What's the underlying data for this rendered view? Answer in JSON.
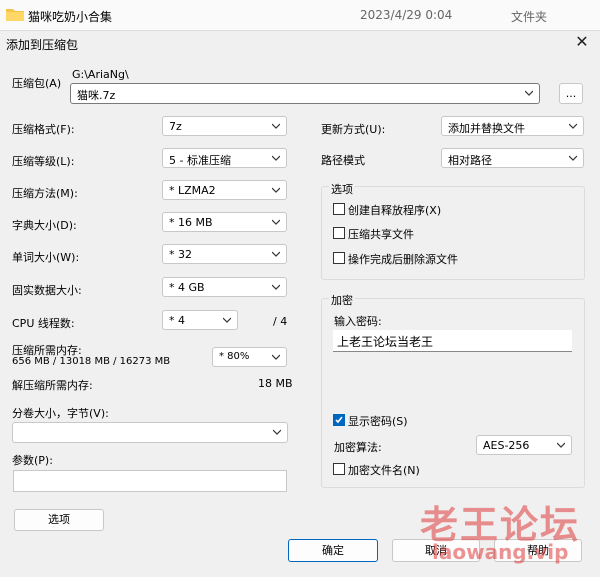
{
  "file_row": {
    "name": "猫咪吃奶小合集",
    "date": "2023/4/29 0:04",
    "type": "文件夹"
  },
  "dialog": {
    "title": "添加到压缩包",
    "close_symbol": "✕"
  },
  "archive": {
    "label": "压缩包(A)",
    "path": "G:\\AriaNg\\",
    "value": "猫咪.7z",
    "browse": "..."
  },
  "fields": {
    "format": {
      "label": "压缩格式(F):",
      "value": "7z"
    },
    "level": {
      "label": "压缩等级(L):",
      "value": "5 - 标准压缩"
    },
    "method": {
      "label": "压缩方法(M):",
      "value": "* LZMA2"
    },
    "dict": {
      "label": "字典大小(D):",
      "value": "* 16 MB"
    },
    "word": {
      "label": "单词大小(W):",
      "value": "* 32"
    },
    "solid": {
      "label": "固实数据大小:",
      "value": "* 4 GB"
    },
    "threads": {
      "label": "CPU 线程数:",
      "value": "* 4",
      "total": "/ 4"
    },
    "memory": {
      "label": "压缩所需内存:",
      "detail": "656 MB / 13018 MB / 16273 MB",
      "value": "* 80%"
    },
    "decomp": {
      "label": "解压缩所需内存:",
      "value": "18 MB"
    },
    "split": {
      "label": "分卷大小，字节(V):",
      "value": ""
    },
    "params": {
      "label": "参数(P):",
      "value": ""
    }
  },
  "update": {
    "label": "更新方式(U):",
    "value": "添加并替换文件"
  },
  "pathmode": {
    "label": "路径模式",
    "value": "相对路径"
  },
  "options": {
    "title": "选项",
    "items": [
      {
        "label": "创建自释放程序(X)",
        "checked": false
      },
      {
        "label": "压缩共享文件",
        "checked": false
      },
      {
        "label": "操作完成后删除源文件",
        "checked": false
      }
    ]
  },
  "encryption": {
    "title": "加密",
    "pw_label": "输入密码:",
    "pw_value": "上老王论坛当老王",
    "show_pw": {
      "label": "显示密码(S)",
      "checked": true
    },
    "algo_label": "加密算法:",
    "algo_value": "AES-256",
    "enc_names": {
      "label": "加密文件名(N)",
      "checked": false
    }
  },
  "buttons": {
    "options": "选项",
    "ok": "确定",
    "cancel": "取消",
    "help": "帮助"
  },
  "watermark": {
    "line1": "老王论坛",
    "line2": "laowang.vip"
  },
  "colors": {
    "accent": "#0067c0",
    "watermark": "#e03b3b"
  }
}
